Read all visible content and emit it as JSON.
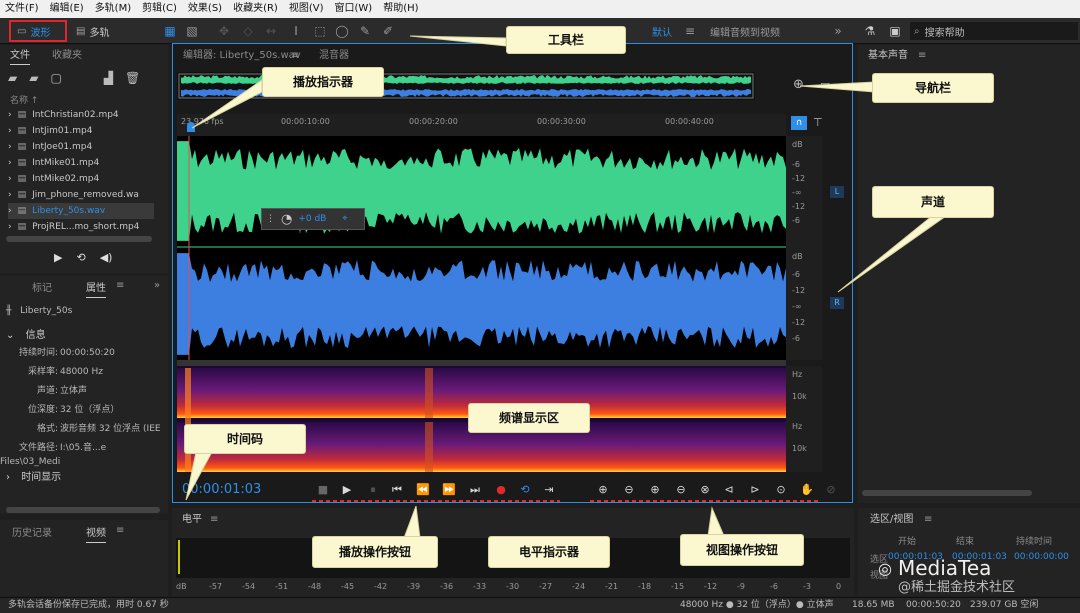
{
  "menu": [
    "文件(F)",
    "编辑(E)",
    "多轨(M)",
    "剪辑(C)",
    "效果(S)",
    "收藏夹(R)",
    "视图(V)",
    "窗口(W)",
    "帮助(H)"
  ],
  "toolbar": {
    "waveform_label": "波形",
    "multitrack_label": "多轨",
    "workspace_label": "默认",
    "workspace_item": "编辑音频到视频",
    "search_placeholder": "搜索帮助"
  },
  "files_panel": {
    "tab_files": "文件",
    "tab_favorites": "收藏夹",
    "col_name": "名称 ↑",
    "files": [
      {
        "name": "IntChristian02.mp4",
        "selected": false
      },
      {
        "name": "IntJim01.mp4",
        "selected": false
      },
      {
        "name": "IntJoe01.mp4",
        "selected": false
      },
      {
        "name": "IntMike01.mp4",
        "selected": false
      },
      {
        "name": "IntMike02.mp4",
        "selected": false
      },
      {
        "name": "Jim_phone_removed.wa",
        "selected": false
      },
      {
        "name": "Liberty_50s.wav",
        "selected": true
      },
      {
        "name": "ProjREL...mo_short.mp4",
        "selected": false
      }
    ]
  },
  "props_panel": {
    "tab_markers": "标记",
    "tab_properties": "属性",
    "file_name": "Liberty_50s",
    "section_info": "信息",
    "rows": [
      {
        "label": "持续时间:",
        "value": "00:00:50:20"
      },
      {
        "label": "采样率:",
        "value": "48000 Hz"
      },
      {
        "label": "声道:",
        "value": "立体声"
      },
      {
        "label": "位深度:",
        "value": "32 位（浮点）"
      },
      {
        "label": "格式:",
        "value": "波形音频 32 位浮点 (IEE"
      },
      {
        "label": "文件路径:",
        "value": "I:\\05.音...e Files\\03_Medi"
      }
    ],
    "section_time": "时间显示"
  },
  "history_panel": {
    "tab_history": "历史记录",
    "tab_video": "视频"
  },
  "editor": {
    "tab_editor": "编辑器: Liberty_50s.wav",
    "tab_mixer": "混音器",
    "fps": "23.976 fps",
    "ruler": [
      "00:00:10:00",
      "00:00:20:00",
      "00:00:30:00",
      "00:00:40:00"
    ],
    "db_left": [
      "dB",
      "-6",
      "-12",
      "-∞",
      "-12",
      "-6"
    ],
    "db_right": [
      "dB",
      "-6",
      "-12",
      "-∞",
      "-12",
      "-6"
    ],
    "hz_top": [
      "Hz",
      "10k"
    ],
    "hz_bottom": [
      "Hz",
      "10k"
    ],
    "channel_left": "L",
    "channel_right": "R",
    "hud_value": "+0 dB",
    "timecode": "00:00:01:03"
  },
  "meter_panel": {
    "title": "电平",
    "scale": [
      "dB",
      "-57",
      "-54",
      "-51",
      "-48",
      "-45",
      "-42",
      "-39",
      "-36",
      "-33",
      "-30",
      "-27",
      "-24",
      "-21",
      "-18",
      "-15",
      "-12",
      "-9",
      "-6",
      "-3",
      "0"
    ]
  },
  "basic_sound": {
    "title": "基本声音"
  },
  "selection_view": {
    "title": "选区/视图",
    "col_start": "开始",
    "col_end": "结束",
    "col_duration": "持续时间",
    "row_sel": "选区",
    "row_view": "视图",
    "sel_start": "00:00:01:03",
    "sel_end": "00:00:01:03",
    "sel_duration": "00:00:00:00"
  },
  "status": {
    "left": "多轨会话备份保存已完成，用时 0.67 秒",
    "rate": "48000 Hz ● 32 位（浮点）● 立体声",
    "size": "18.65 MB",
    "duration": "00:00:50:20",
    "free": "239.07 GB 空闲"
  },
  "annotations": {
    "toolbar": "工具栏",
    "playhead": "播放指示器",
    "navbar": "导航栏",
    "channels": "声道",
    "spectrum": "频谱显示区",
    "timecode": "时间码",
    "transport": "播放操作按钮",
    "level": "电平指示器",
    "view_ops": "视图操作按钮"
  },
  "watermark": "MediaTea",
  "watermark_sub": "@稀土掘金技术社区",
  "colors": {
    "accent": "#2f8fe8",
    "wave_left": "#3fd28c",
    "wave_right": "#3d7fe0",
    "callout": "#fbf7cf",
    "highlight": "#e0262b"
  }
}
